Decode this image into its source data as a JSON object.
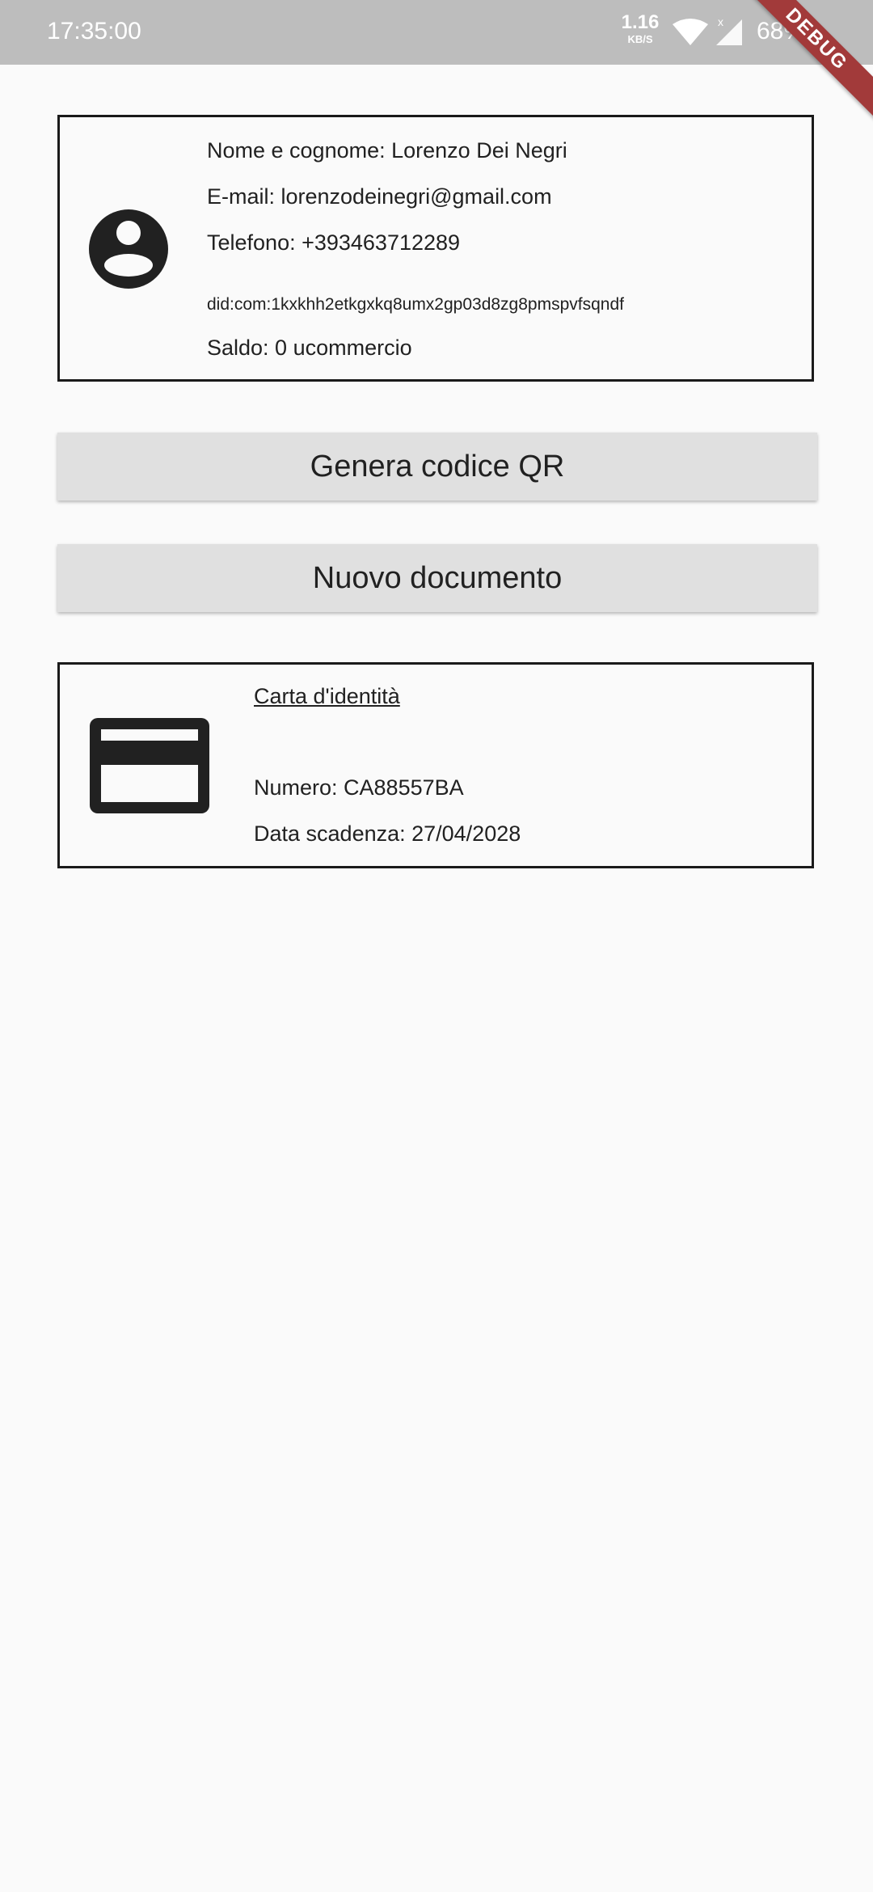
{
  "status_bar": {
    "time": "17:35:00",
    "net_speed_value": "1.16",
    "net_speed_unit": "KB/S",
    "battery": "68%"
  },
  "debug_banner": "DEBUG",
  "profile": {
    "name_line": "Nome e cognome: Lorenzo Dei Negri",
    "email_line": "E-mail: lorenzodeinegri@gmail.com",
    "phone_line": "Telefono: +393463712289",
    "did_line": "did:com:1kxkhh2etkgxkq8umx2gp03d8zg8pmspvfsqndf",
    "balance_line": "Saldo: 0 ucommercio"
  },
  "buttons": {
    "generate_qr": "Genera codice QR",
    "new_document": "Nuovo documento"
  },
  "document": {
    "title": "Carta d'identità",
    "number_line": "Numero: CA88557BA",
    "expiry_line": "Data scadenza: 27/04/2028"
  },
  "icons": {
    "avatar": "account-circle-icon",
    "document": "credit-card-icon",
    "wifi": "wifi-icon",
    "signal": "signal-icon",
    "battery": "battery-icon"
  },
  "colors": {
    "status_bar": "#bdbdbd",
    "background": "#fafafa",
    "button": "#e0e0e0",
    "text": "#212121",
    "debug_banner": "#a23a3a"
  }
}
